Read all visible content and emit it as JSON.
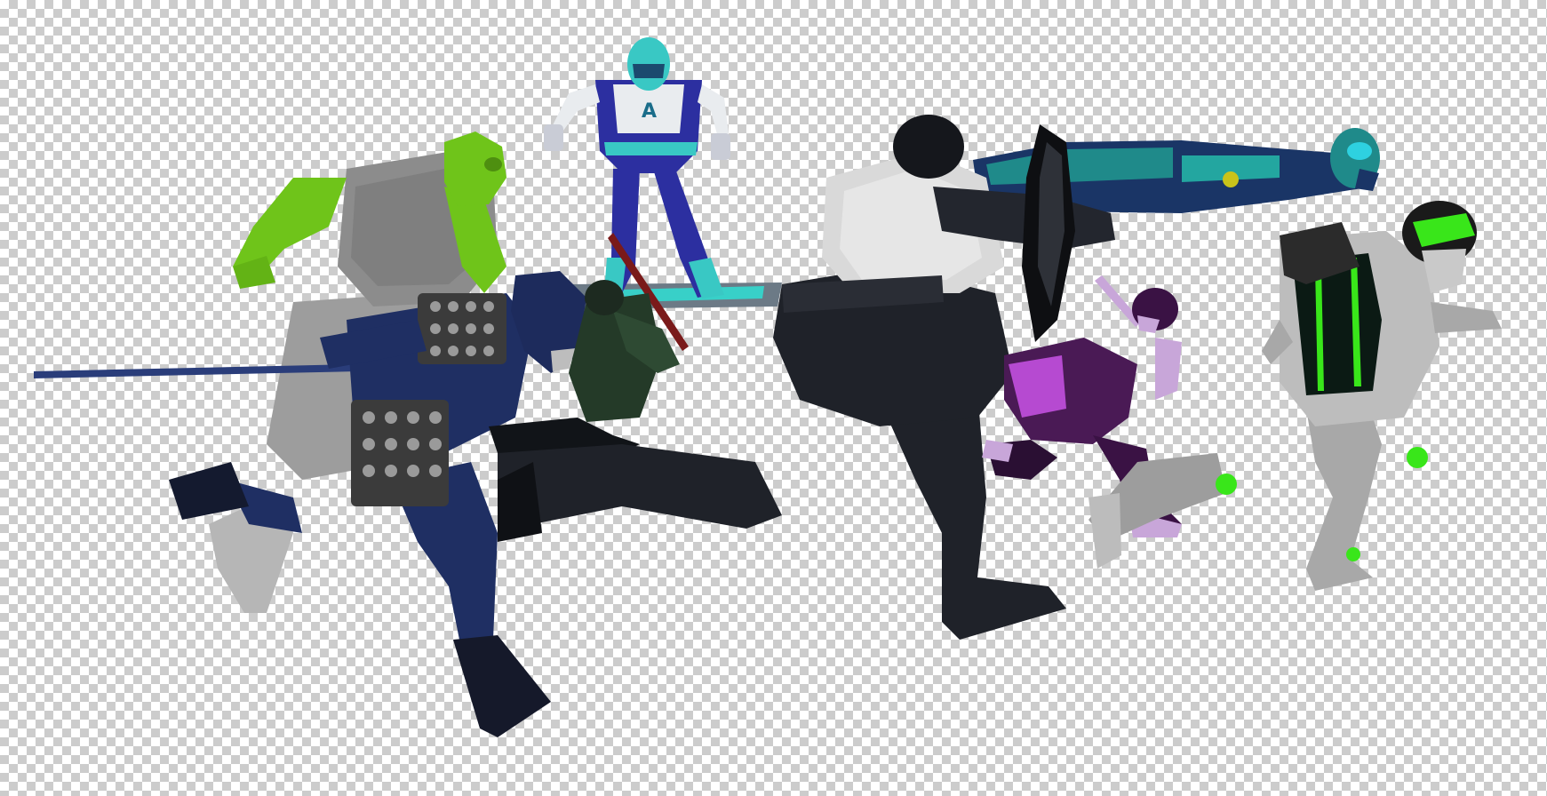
{
  "image": {
    "background": "transparency-checkerboard",
    "colors": {
      "checker_light": "#ffffff",
      "checker_dark": "#cccccc",
      "hulk_green": "#6fc41a",
      "ninja_blue": "#1f2f63",
      "brute_black": "#1f2229",
      "hoverboard_blue": "#3a3fa8",
      "flyer_teal": "#1f8a8a",
      "purple_ninja": "#4a1a55",
      "robot_gray": "#a8a8a8",
      "robot_neon": "#39e61a"
    },
    "figures": [
      "green-brute-figure",
      "blue-armored-swordsman-figure",
      "green-soldier-figure",
      "hoverboard-rider-figure",
      "black-caped-brute-figure",
      "teal-flying-figure",
      "purple-ninja-figure",
      "neon-robot-runner-figure"
    ]
  }
}
